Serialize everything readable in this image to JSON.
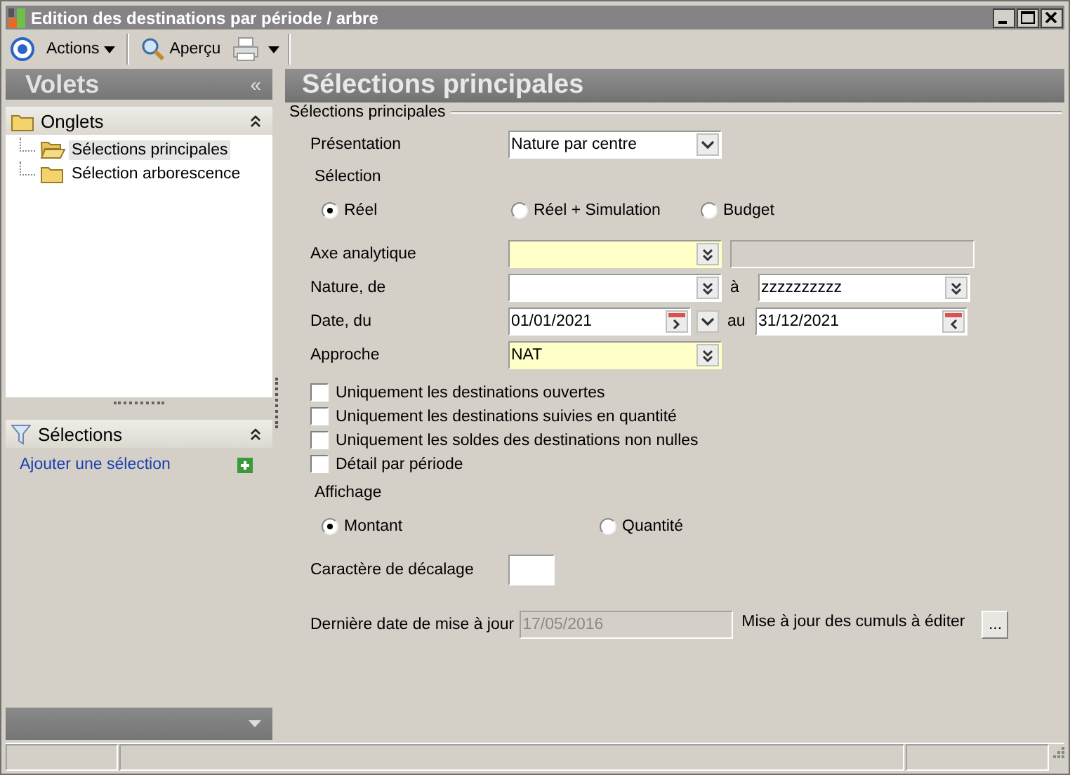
{
  "window": {
    "title": "Edition des destinations par période / arbre"
  },
  "toolbar": {
    "actions": "Actions",
    "preview": "Aperçu"
  },
  "sidebar": {
    "title": "Volets",
    "collapse": "«",
    "sections": [
      {
        "kind": "tree",
        "title": "Onglets",
        "items": [
          {
            "label": "Sélections principales",
            "selected": true
          },
          {
            "label": "Sélection arborescence",
            "selected": false
          }
        ]
      },
      {
        "kind": "filters",
        "title": "Sélections",
        "link": "Ajouter une sélection"
      }
    ]
  },
  "content": {
    "title": "Sélections principales",
    "group": "Sélections principales",
    "form": [
      {
        "kind": "combo",
        "label": "Présentation",
        "value": "Nature par centre"
      },
      {
        "kind": "heading",
        "label": "Sélection"
      },
      {
        "kind": "radios",
        "options": [
          {
            "label": "Réel",
            "selected": true
          },
          {
            "label": "Réel + Simulation",
            "selected": false
          },
          {
            "label": "Budget",
            "selected": false
          }
        ]
      },
      {
        "kind": "lookup",
        "label": "Axe analytique",
        "required": true,
        "description_field": {
          "disabled": true
        }
      },
      {
        "kind": "range",
        "label": "Nature, de",
        "separator": "à",
        "to": "zzzzzzzzzz"
      },
      {
        "kind": "dates",
        "label": "Date, du",
        "from": "01/01/2021",
        "separator": "au",
        "to": "31/12/2021"
      },
      {
        "kind": "lookup",
        "label": "Approche",
        "value": "NAT",
        "required": true
      },
      {
        "kind": "checkbox",
        "label": "Uniquement les destinations ouvertes",
        "checked": false
      },
      {
        "kind": "checkbox",
        "label": "Uniquement les destinations suivies en quantité",
        "checked": false
      },
      {
        "kind": "checkbox",
        "label": "Uniquement les soldes des destinations non nulles",
        "checked": false
      },
      {
        "kind": "checkbox",
        "label": "Détail par période",
        "checked": false
      },
      {
        "kind": "heading",
        "label": "Affichage"
      },
      {
        "kind": "radios",
        "options": [
          {
            "label": "Montant",
            "selected": true
          },
          {
            "label": "Quantité",
            "selected": false
          }
        ]
      },
      {
        "kind": "char",
        "label": "Caractère de décalage"
      },
      {
        "kind": "update",
        "label": "Dernière date de mise à jour",
        "value": "17/05/2016",
        "disabled": true,
        "action": "Mise à jour des cumuls à éditer",
        "button": "..."
      }
    ]
  }
}
